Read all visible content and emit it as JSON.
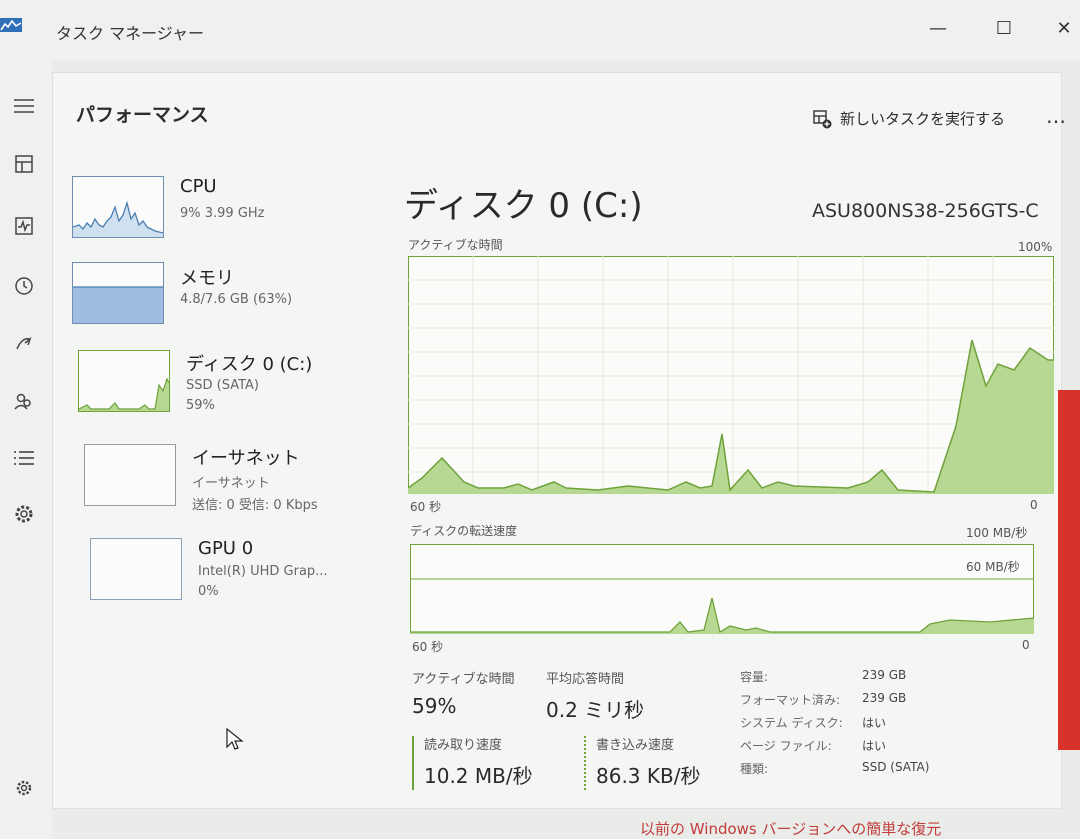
{
  "window": {
    "title": "タスク マネージャー",
    "min_label": "—",
    "max_label": "☐",
    "close_label": "✕"
  },
  "nav": {
    "icons": [
      "hamburger-icon",
      "processes-icon",
      "performance-icon",
      "app-history-icon",
      "startup-apps-icon",
      "users-icon",
      "details-icon",
      "services-icon",
      "settings-icon"
    ]
  },
  "header": {
    "title": "パフォーマンス",
    "run_new_task": "新しいタスクを実行する",
    "more": "…"
  },
  "resources": [
    {
      "name": "CPU",
      "line1": "9%  3.99 GHz",
      "line2": "",
      "line3": ""
    },
    {
      "name": "メモリ",
      "line1": "4.8/7.6 GB (63%)",
      "line2": "",
      "line3": ""
    },
    {
      "name": "ディスク 0 (C:)",
      "line1": "SSD (SATA)",
      "line2": "59%",
      "line3": ""
    },
    {
      "name": "イーサネット",
      "line1": "イーサネット",
      "line2": "送信: 0 受信: 0 Kbps",
      "line3": ""
    },
    {
      "name": "GPU 0",
      "line1": "Intel(R) UHD Grap...",
      "line2": "0%",
      "line3": ""
    }
  ],
  "detail": {
    "title": "ディスク 0 (C:)",
    "model": "ASU800NS38-256GTS-C",
    "graph1": {
      "label": "アクティブな時間",
      "max": "100%",
      "time": "60 秒",
      "zero": "0"
    },
    "graph2": {
      "label": "ディスクの転送速度",
      "max": "100 MB/秒",
      "line": "60 MB/秒",
      "time": "60 秒",
      "zero": "0"
    },
    "stats": {
      "active_time_label": "アクティブな時間",
      "active_time_value": "59%",
      "avg_response_label": "平均応答時間",
      "avg_response_value": "0.2 ミリ秒",
      "read_label": "読み取り速度",
      "read_value": "10.2 MB/秒",
      "write_label": "書き込み速度",
      "write_value": "86.3 KB/秒"
    },
    "info": [
      {
        "label": "容量:",
        "value": "239 GB"
      },
      {
        "label": "フォーマット済み:",
        "value": "239 GB"
      },
      {
        "label": "システム ディスク:",
        "value": "はい"
      },
      {
        "label": "ページ ファイル:",
        "value": "はい"
      },
      {
        "label": "種類:",
        "value": "SSD (SATA)"
      }
    ]
  },
  "footer": {
    "link": "以前の Windows バージョンへの簡単な復元"
  },
  "colors": {
    "disk_fill": "#b7d892",
    "disk_line": "#6ea23a",
    "cpu_line": "#4a7fb0",
    "mem_fill": "#9fbde0",
    "accent_red": "#d8332b"
  }
}
